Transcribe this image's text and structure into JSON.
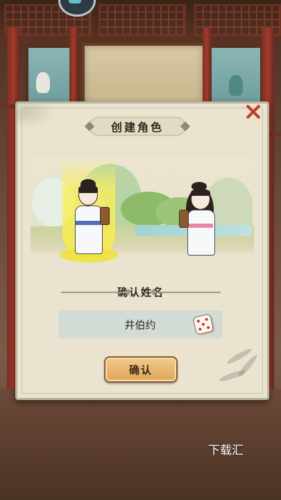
{
  "dialog": {
    "title": "创建角色",
    "name_section_label": "确认姓名",
    "name_value": "井伯约",
    "confirm_label": "确认"
  },
  "characters": [
    {
      "gender": "male",
      "selected": true
    },
    {
      "gender": "female",
      "selected": false
    }
  ],
  "icons": {
    "close": "close-icon",
    "dice": "dice-icon",
    "top_badge": "app-badge-icon"
  },
  "colors": {
    "close": "#c23a2c",
    "confirm_button": "#e0a55a",
    "selection_highlight": "#f8ec46"
  },
  "watermark": "下载汇"
}
